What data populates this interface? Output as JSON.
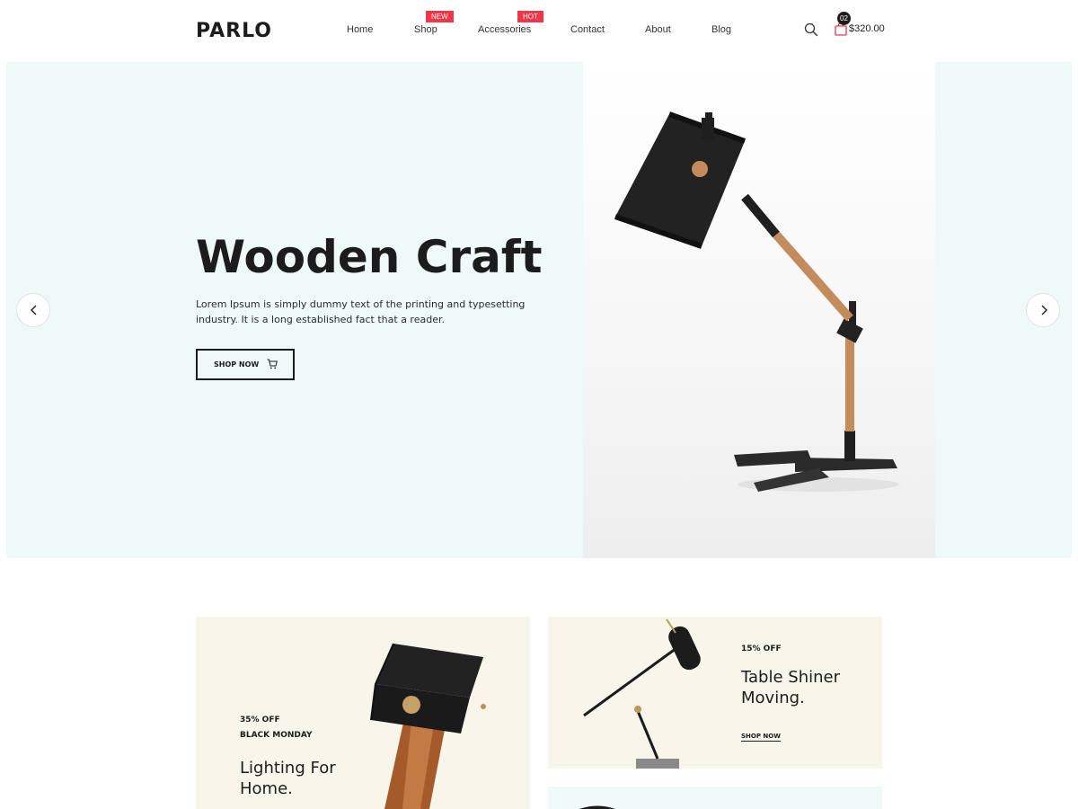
{
  "header": {
    "logo": "PARLO",
    "nav": [
      {
        "label": "Home"
      },
      {
        "label": "Shop",
        "badge": "NEW"
      },
      {
        "label": "Accessories",
        "badge": "HOT"
      },
      {
        "label": "Contact"
      },
      {
        "label": "About"
      },
      {
        "label": "Blog"
      }
    ],
    "search_icon": "search-icon",
    "cart_icon": "shopping-bag-icon",
    "cart_count": "02",
    "cart_total": "$320.00",
    "badge_color": "#f0374a"
  },
  "hero": {
    "title": "Wooden Craft",
    "text": "Lorem Ipsum is simply dummy text of the printing and typesetting industry. It is a long established fact that a reader.",
    "button_label": "SHOP NOW",
    "button_icon": "cart-icon",
    "prev_icon": "chevron-left-icon",
    "next_icon": "chevron-right-icon",
    "background": "#eef9f8"
  },
  "promos": {
    "a": {
      "discount": "35% OFF",
      "tag": "BLACK MONDAY",
      "title_line1": "Lighting For",
      "title_line2": "Home."
    },
    "b": {
      "discount": "15% OFF",
      "title_line1": "Table Shiner",
      "title_line2": "Moving.",
      "link": "SHOP NOW"
    }
  }
}
